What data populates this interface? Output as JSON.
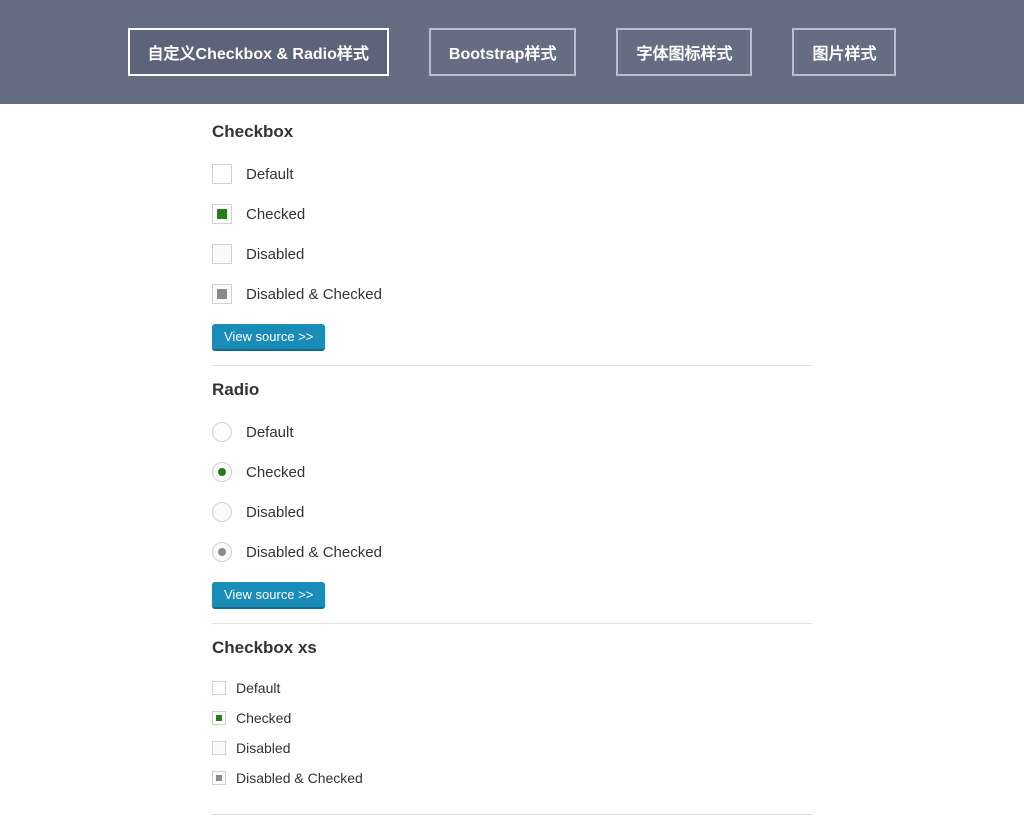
{
  "nav": {
    "items": [
      {
        "label": "自定义Checkbox & Radio样式",
        "active": true
      },
      {
        "label": "Bootstrap样式",
        "active": false
      },
      {
        "label": "字体图标样式",
        "active": false
      },
      {
        "label": "图片样式",
        "active": false
      }
    ]
  },
  "sections": {
    "checkbox": {
      "title": "Checkbox",
      "items": [
        {
          "label": "Default",
          "checked": false,
          "disabled": false
        },
        {
          "label": "Checked",
          "checked": true,
          "disabled": false
        },
        {
          "label": "Disabled",
          "checked": false,
          "disabled": true
        },
        {
          "label": "Disabled & Checked",
          "checked": true,
          "disabled": true
        }
      ],
      "view_source_label": "View source >>"
    },
    "radio": {
      "title": "Radio",
      "items": [
        {
          "label": "Default",
          "checked": false,
          "disabled": false
        },
        {
          "label": "Checked",
          "checked": true,
          "disabled": false
        },
        {
          "label": "Disabled",
          "checked": false,
          "disabled": true
        },
        {
          "label": "Disabled & Checked",
          "checked": true,
          "disabled": true
        }
      ],
      "view_source_label": "View source >>"
    },
    "checkbox_xs": {
      "title": "Checkbox xs",
      "items": [
        {
          "label": "Default",
          "checked": false,
          "disabled": false
        },
        {
          "label": "Checked",
          "checked": true,
          "disabled": false
        },
        {
          "label": "Disabled",
          "checked": false,
          "disabled": true
        },
        {
          "label": "Disabled & Checked",
          "checked": true,
          "disabled": true
        }
      ]
    }
  }
}
